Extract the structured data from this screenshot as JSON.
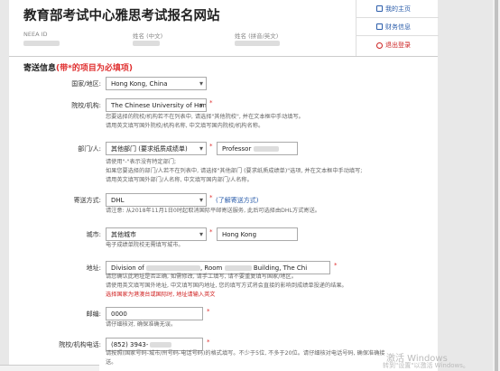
{
  "site": {
    "title": "教育部考试中心雅思考试报名网站"
  },
  "id_row": {
    "neea_label": "NEEA ID",
    "cn_name_label": "姓名 (中文)",
    "py_name_label": "姓名 (拼音/英文)"
  },
  "side_menu": [
    {
      "label": "我的主页",
      "icon": "home-icon"
    },
    {
      "label": "财务信息",
      "icon": "finance-icon"
    },
    {
      "label": "退出登录",
      "icon": "logout-icon"
    }
  ],
  "section": {
    "title": "寄送信息",
    "req_note": "(带*的项目为必填项)"
  },
  "fields": {
    "region": {
      "label": "国家/地区:",
      "value": "Hong Kong, China"
    },
    "school": {
      "label": "院校/机构:",
      "value": "The Chinese University of Hon",
      "hint1": "您要选择的院校/机构若不在列表中, 请选择\"其他院校\", 并在文本框中手动填写。",
      "hint2": "请用英文填写国外院校/机构名称, 中文填写国内院校/机构名称。"
    },
    "department": {
      "label": "部门/人:",
      "select": "其他部门 (要求纸质成绩单)",
      "input": "Professor",
      "hint1": "请使用\"-\"表示没有特定部门;",
      "hint2": "如果您要选择的部门/人若不在列表中, 请选择\"其他部门 (要求纸质成绩单)\"选项, 并在文本框中手动填写;",
      "hint3": "请用英文填写国外部门/人名称, 中文填写国内部门/人名称。"
    },
    "delivery": {
      "label": "寄送方式:",
      "value": "DHL",
      "link": "(了解寄送方式)",
      "hint1": "请注意: 从2018年11月1日0时起取消国际平邮寄送服务, 此后可选择由DHL方式寄送。"
    },
    "city": {
      "label": "城市:",
      "select": "其他城市",
      "input": "Hong Kong",
      "hint1": "电子成绩单院校无需填写城市。"
    },
    "address": {
      "label": "地址:",
      "value_a": "Division of",
      "value_b": ", Room",
      "value_c": "Building, The Chi",
      "hint1": "请您确认此地址是否正确, 如需修改, 请手工填写, 请不要重复填写国家/地区。",
      "hint2": "请使用英文填写国外地址, 中文填写国内地址, 您的填写方式将会直接的影响到成绩单投递的结果。",
      "hint3": "选择国家为港澳台或国际时, 地址请输入英文"
    },
    "postcode": {
      "label": "邮编:",
      "value": "0000",
      "hint1": "请仔细核对, 确保准确无误。"
    },
    "phone": {
      "label": "院校/机构电话:",
      "value": "(852) 3943-",
      "hint1": "请按照(国家号码-城市/州号码-电话号码)的格式填写。不少于5位, 不多于20位。请仔细核对电话号码, 确保准确接",
      "hint2": "送。"
    }
  },
  "watermark": {
    "line1": "激活 Windows",
    "line2": "转到\"设置\"以激活 Windows。"
  },
  "status_text": "",
  "colors": {
    "link": "#2a5caa",
    "required": "#e03030",
    "divider": "#cccccc"
  }
}
